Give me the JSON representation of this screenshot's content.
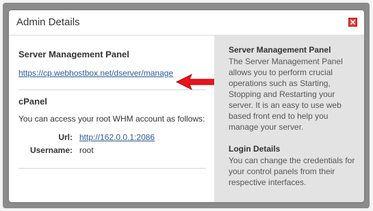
{
  "dialog": {
    "title": "Admin Details"
  },
  "left": {
    "server_title": "Server Management Panel",
    "server_link": "https://cp.webhostbox.net/dserver/manage",
    "cpanel_title": "cPanel",
    "cpanel_intro": "You can access your root WHM account as follows:",
    "url_label": "Url:",
    "url_value": "http://162.0.0.1:2086",
    "username_label": "Username:",
    "username_value": "root"
  },
  "right": {
    "server_title": "Server Management Panel",
    "server_desc": "The Server Management Panel allows you to perform crucial operations such as Starting, Stopping and Restarting your server. It is an easy to use web based front end to help you manage your server.",
    "login_title": "Login Details",
    "login_desc": "You can change the credentials for your control panels from their respective interfaces."
  },
  "colors": {
    "close_button": "#e23c3c",
    "arrow": "#e8141b",
    "link": "#2a5a94",
    "side_panel": "#e3e3e3"
  },
  "icons": [
    "close-icon",
    "arrow-pointer-icon"
  ]
}
